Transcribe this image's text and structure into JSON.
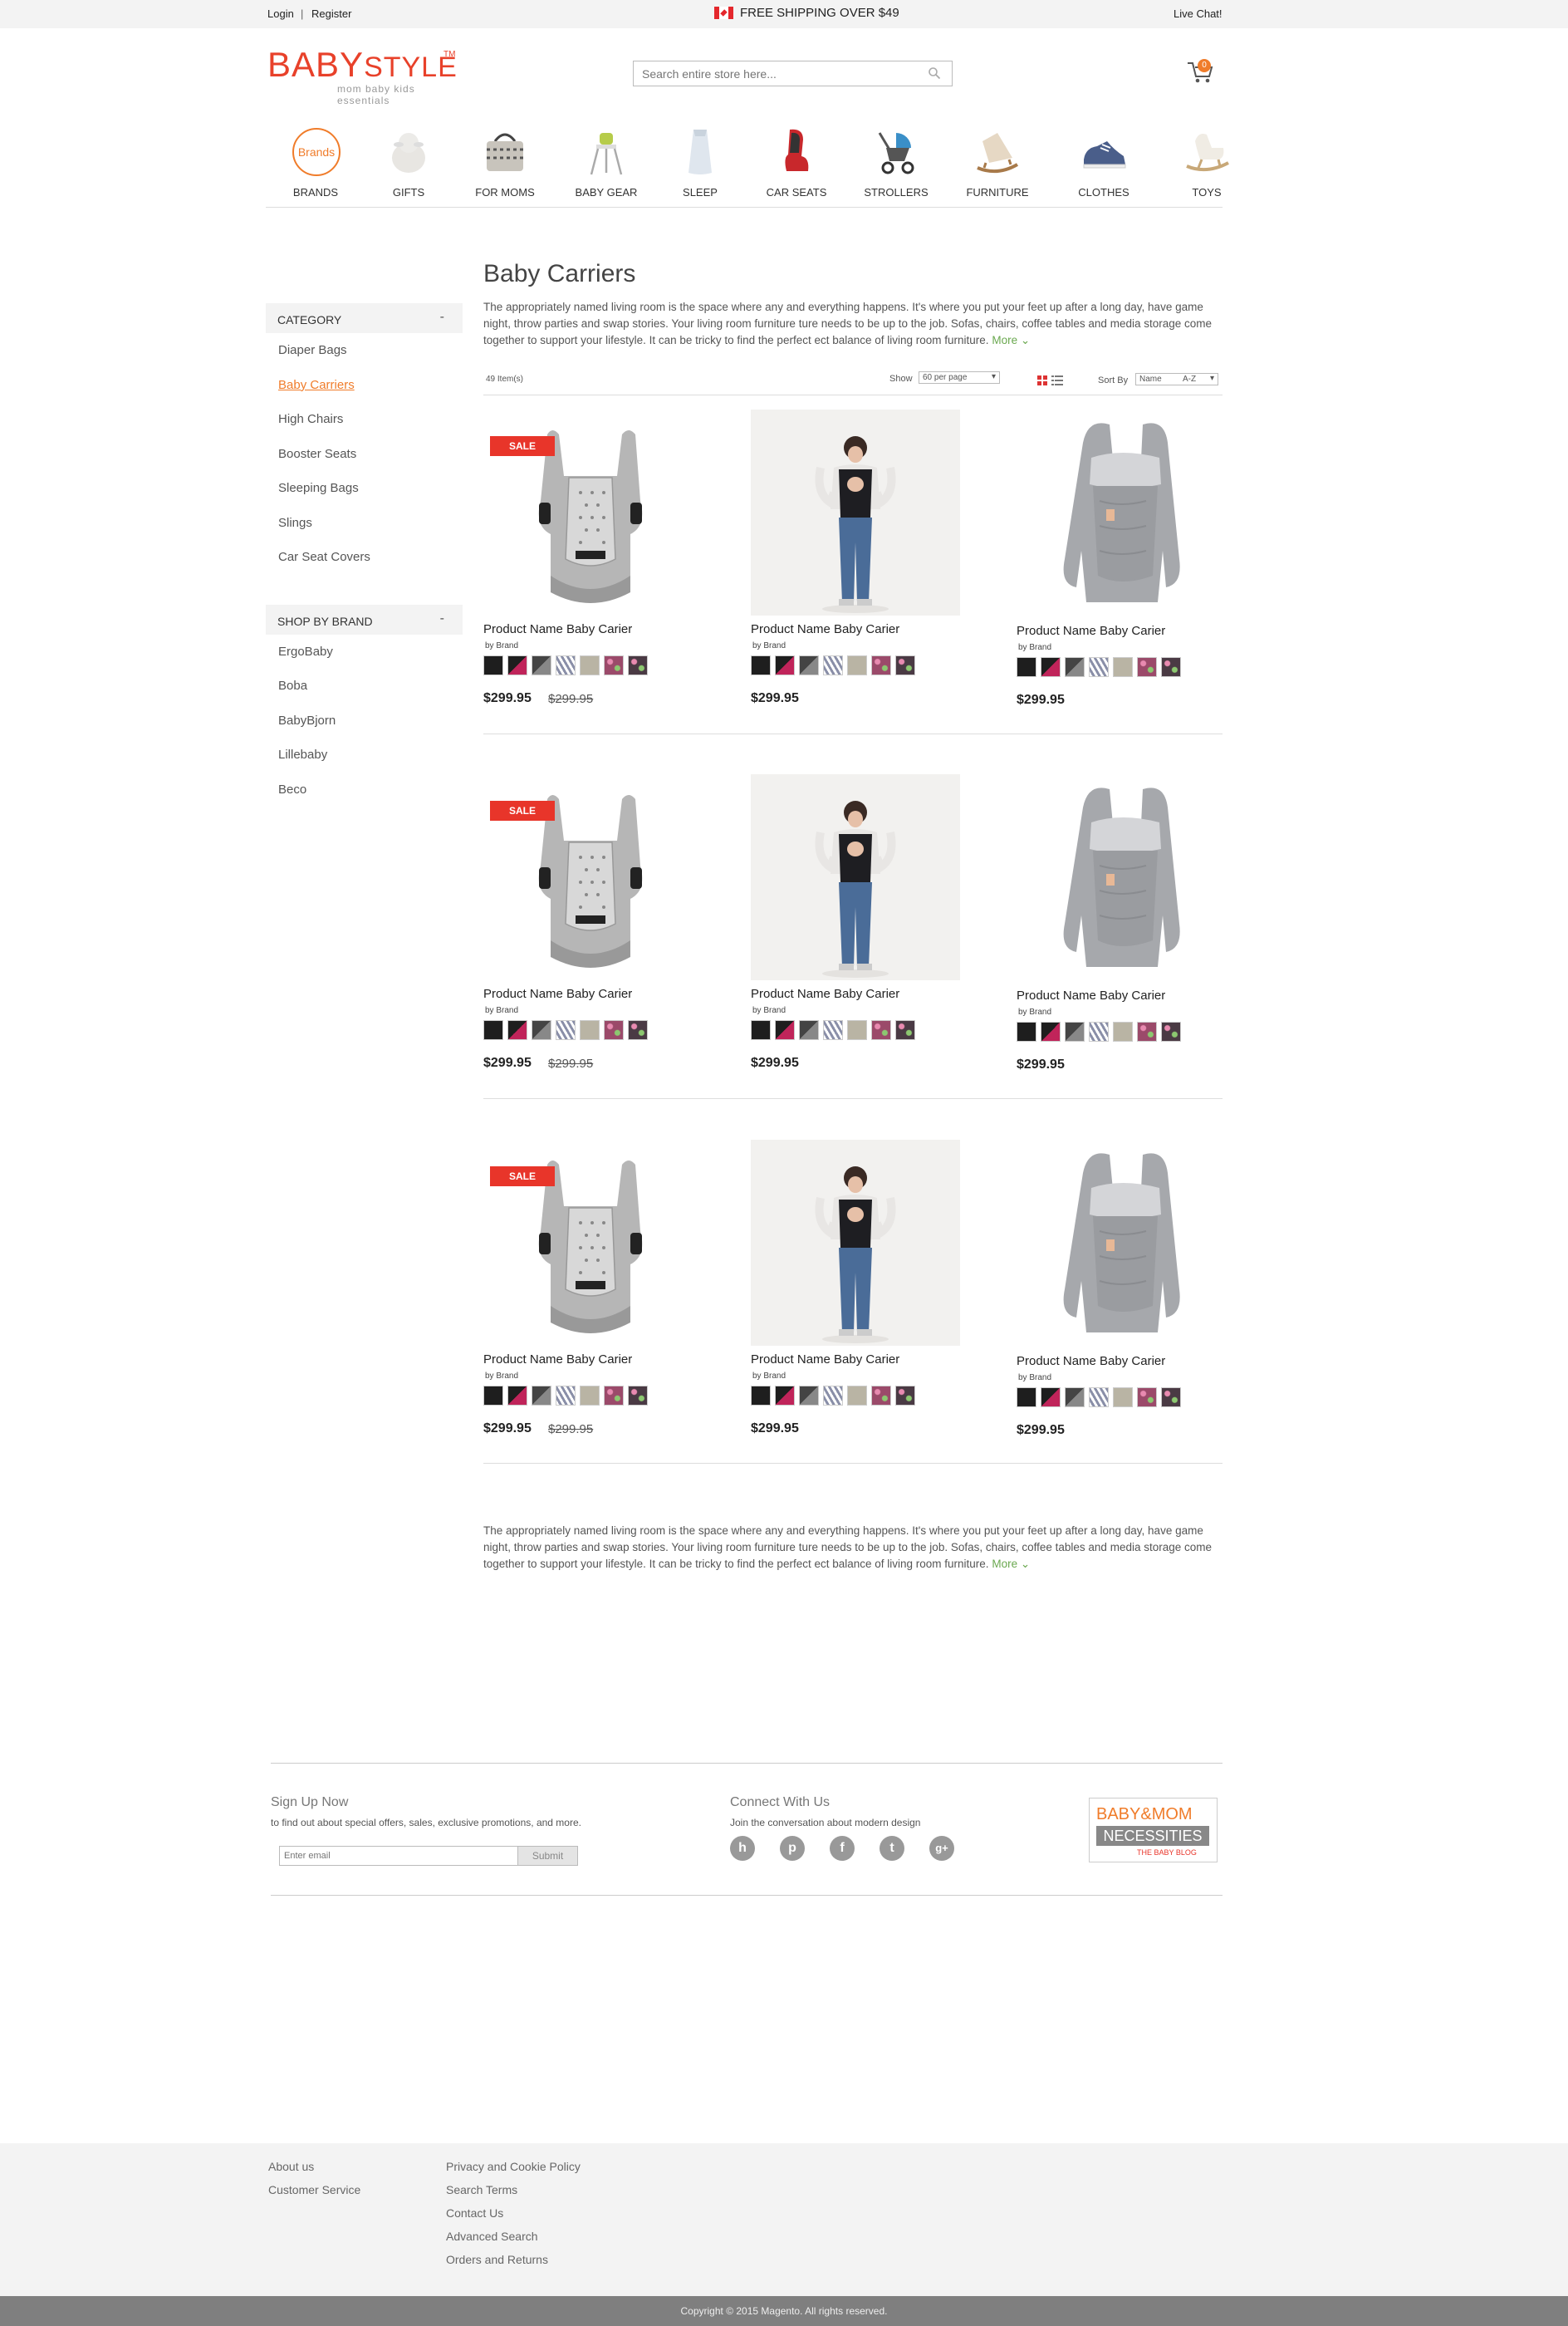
{
  "topbar": {
    "login": "Login",
    "separator": "|",
    "register": "Register",
    "shipping": "FREE SHIPPING OVER $49",
    "live_chat": "Live Chat!"
  },
  "header": {
    "logo_main": "BABY",
    "logo_style": "STYLE",
    "logo_tm": "TM",
    "logo_tagline": "mom baby kids essentials",
    "search_placeholder": "Search entire store here...",
    "cart_count": "0"
  },
  "nav": [
    {
      "label": "BRANDS",
      "icon": "brands-badge",
      "badge": "Brands"
    },
    {
      "label": "GIFTS",
      "icon": "lamb-plush-icon"
    },
    {
      "label": "FOR MOMS",
      "icon": "diaper-bag-icon"
    },
    {
      "label": "BABY GEAR",
      "icon": "high-chair-icon"
    },
    {
      "label": "SLEEP",
      "icon": "sleep-sack-icon"
    },
    {
      "label": "CAR SEATS",
      "icon": "car-seat-icon"
    },
    {
      "label": "STROLLERS",
      "icon": "stroller-icon"
    },
    {
      "label": "FURNITURE",
      "icon": "rocker-icon"
    },
    {
      "label": "CLOTHES",
      "icon": "sneaker-icon"
    },
    {
      "label": "TOYS",
      "icon": "rocking-horse-icon"
    }
  ],
  "sidebar": {
    "category_title": "CATEGORY",
    "categories": [
      "Diaper Bags",
      "Baby Carriers",
      "High Chairs",
      "Booster Seats",
      "Sleeping Bags",
      "Slings",
      "Car Seat Covers"
    ],
    "active_category": "Baby Carriers",
    "brand_title": "SHOP BY BRAND",
    "brands": [
      "ErgoBaby",
      "Boba",
      "BabyBjorn",
      "Lillebaby",
      "Beco"
    ],
    "collapse_symbol": "-"
  },
  "main": {
    "title": "Baby Carriers",
    "description": "The appropriately named living room is the      space where any      and everything  happens. It's where you    put your feet up after a long day, have game night, throw parties and swap stories. Your living room furniture  ture  needs to be up to the job.      Sofas, chairs, coffee tables     and media storage come together to support your lifestyle. It can be tricky to find the perfect  ect      balance of living room furniture.",
    "more": "More",
    "item_count": "49 Item(s)",
    "show_label": "Show",
    "per_page": "60 per page",
    "sort_label": "Sort By",
    "sort_field": "Name",
    "sort_dir": "A-Z"
  },
  "products": [
    {
      "name": "Product Name Baby Carier",
      "brand": "by Brand",
      "price": "$299.95",
      "old_price": "$299.95",
      "sale": "SALE",
      "image": "mesh-carrier-image"
    },
    {
      "name": "Product Name Baby Carier",
      "brand": "by Brand",
      "price": "$299.95",
      "old_price": "",
      "sale": "",
      "image": "woman-carrier-image"
    },
    {
      "name": "Product Name Baby Carier",
      "brand": "by Brand",
      "price": "$299.95",
      "old_price": "",
      "sale": "",
      "image": "grey-carrier-image"
    },
    {
      "name": "Product Name Baby Carier",
      "brand": "by Brand",
      "price": "$299.95",
      "old_price": "$299.95",
      "sale": "SALE",
      "image": "mesh-carrier-image"
    },
    {
      "name": "Product Name Baby Carier",
      "brand": "by Brand",
      "price": "$299.95",
      "old_price": "",
      "sale": "",
      "image": "woman-carrier-image"
    },
    {
      "name": "Product Name Baby Carier",
      "brand": "by Brand",
      "price": "$299.95",
      "old_price": "",
      "sale": "",
      "image": "grey-carrier-image"
    },
    {
      "name": "Product Name Baby Carier",
      "brand": "by Brand",
      "price": "$299.95",
      "old_price": "$299.95",
      "sale": "SALE",
      "image": "mesh-carrier-image"
    },
    {
      "name": "Product Name Baby Carier",
      "brand": "by Brand",
      "price": "$299.95",
      "old_price": "",
      "sale": "",
      "image": "woman-carrier-image"
    },
    {
      "name": "Product Name Baby Carier",
      "brand": "by Brand",
      "price": "$299.95",
      "old_price": "",
      "sale": "",
      "image": "grey-carrier-image"
    }
  ],
  "swatch_colors": [
    "#1e1e1e",
    "#c0245a",
    "#5a5a5a",
    "#8a8fa8",
    "#b9b4a4",
    "#9b4a6a",
    "#4a3a44"
  ],
  "signup": {
    "title": "Sign Up Now",
    "subtitle": "to find out about special offers, sales, exclusive promotions, and more.",
    "email_placeholder": "Enter email",
    "submit": "Submit"
  },
  "connect": {
    "title": "Connect With Us",
    "subtitle": "Join the conversation about modern design",
    "networks": [
      "houzz-icon",
      "pinterest-icon",
      "facebook-icon",
      "twitter-icon",
      "google-plus-icon"
    ]
  },
  "blog_badge": {
    "line1": "BABY&MOM",
    "line2": "NECESSITIES",
    "line3": "THE BABY BLOG"
  },
  "footer": {
    "col1": [
      "About us",
      "Customer Service"
    ],
    "col2": [
      "Privacy and Cookie Policy",
      "Search Terms",
      "Contact Us",
      "Advanced Search",
      "Orders and Returns"
    ],
    "copyright": "Copyright © 2015 Magento. All rights reserved."
  },
  "colors": {
    "accent": "#f07c2a",
    "sale": "#e8352a",
    "logo": "#e8412a",
    "more_link": "#6aa84f"
  }
}
